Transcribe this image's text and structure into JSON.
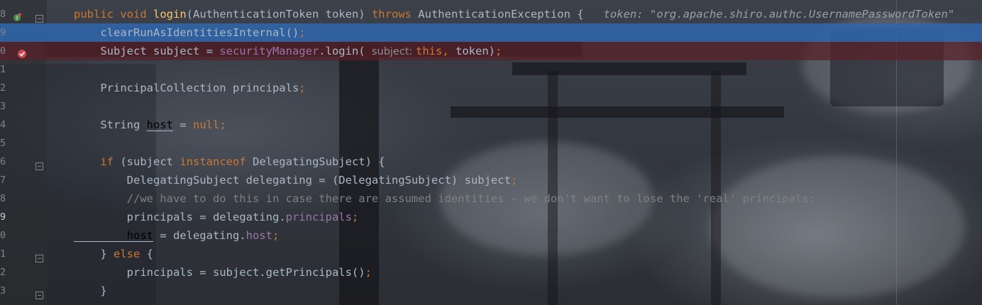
{
  "editor": {
    "lines": [
      {
        "num": "8",
        "tokens": [
          [
            "kw",
            "public "
          ],
          [
            "kw",
            "void "
          ],
          [
            "fn",
            "login"
          ],
          [
            "id",
            "(AuthenticationToken token) "
          ],
          [
            "kw",
            "throws "
          ],
          [
            "id",
            "AuthenticationException {"
          ]
        ],
        "inline": "token: \"org.apache.shiro.authc.UsernamePasswordToken\""
      },
      {
        "num": "9",
        "tokens": [
          [
            "id",
            "    clearRunAsIdentitiesInternal()"
          ],
          [
            "kw",
            ";"
          ]
        ]
      },
      {
        "num": "0",
        "tokens": [
          [
            "id",
            "    Subject subject = "
          ],
          [
            "field",
            "securityManager"
          ],
          [
            "id",
            ".login( "
          ],
          [
            "hint",
            "subject: "
          ],
          [
            "kw",
            "this"
          ],
          [
            "kw",
            ", "
          ],
          [
            "id",
            "token)"
          ],
          [
            "kw",
            ";"
          ]
        ]
      },
      {
        "num": "1",
        "tokens": []
      },
      {
        "num": "2",
        "tokens": [
          [
            "id",
            "    PrincipalCollection principals"
          ],
          [
            "kw",
            ";"
          ]
        ]
      },
      {
        "num": "3",
        "tokens": []
      },
      {
        "num": "4",
        "tokens": [
          [
            "id",
            "    String "
          ],
          [
            "und",
            "host"
          ],
          [
            "id",
            " = "
          ],
          [
            "kw",
            "null"
          ],
          [
            "kw",
            ";"
          ]
        ]
      },
      {
        "num": "5",
        "tokens": []
      },
      {
        "num": "6",
        "tokens": [
          [
            "kw",
            "    if "
          ],
          [
            "id",
            "(subject "
          ],
          [
            "kw",
            "instanceof "
          ],
          [
            "id",
            "DelegatingSubject) {"
          ]
        ]
      },
      {
        "num": "7",
        "tokens": [
          [
            "id",
            "        DelegatingSubject delegating = (DelegatingSubject) subject"
          ],
          [
            "kw",
            ";"
          ]
        ]
      },
      {
        "num": "8",
        "tokens": [
          [
            "cm",
            "        //we have to do this in case there are assumed identities - we don't want to lose the 'real' principals:"
          ]
        ]
      },
      {
        "num": "9",
        "tokens": [
          [
            "id",
            "        principals = delegating."
          ],
          [
            "field",
            "principals"
          ],
          [
            "kw",
            ";"
          ]
        ]
      },
      {
        "num": "0",
        "tokens": [
          [
            "und",
            "        host"
          ],
          [
            "id",
            " = delegating."
          ],
          [
            "field",
            "host"
          ],
          [
            "kw",
            ";"
          ]
        ]
      },
      {
        "num": "1",
        "tokens": [
          [
            "id",
            "    } "
          ],
          [
            "kw",
            "else "
          ],
          [
            "id",
            "{"
          ]
        ]
      },
      {
        "num": "2",
        "tokens": [
          [
            "id",
            "        principals = subject.getPrincipals()"
          ],
          [
            "kw",
            ";"
          ]
        ]
      },
      {
        "num": "3",
        "tokens": [
          [
            "id",
            "    }"
          ]
        ]
      }
    ],
    "current_line_index": 11,
    "selected_line_index": 1,
    "breakpoint_line_index": 2
  },
  "gutter_icons": {
    "line0": "override-implements-icon",
    "line2": "breakpoint-hit-icon"
  },
  "colors": {
    "selection": "#2f65aa",
    "breakpoint_line": "#5a2028",
    "keyword": "#cc7832",
    "method": "#ffc66d",
    "field": "#9876aa"
  }
}
